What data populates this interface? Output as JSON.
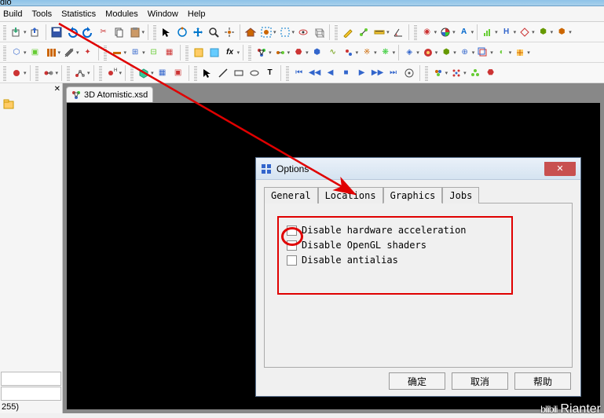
{
  "app": {
    "title_fragment": "dio"
  },
  "menu": {
    "items": [
      "Build",
      "Tools",
      "Statistics",
      "Modules",
      "Window",
      "Help"
    ]
  },
  "document": {
    "tab_label": "3D Atomistic.xsd"
  },
  "dialog": {
    "title": "Options",
    "tabs": [
      "General",
      "Locations",
      "Graphics",
      "Jobs"
    ],
    "active_tab": "Graphics",
    "graphics": {
      "chk1": "Disable hardware acceleration",
      "chk2": "Disable OpenGL shaders",
      "chk3": "Disable antialias"
    },
    "buttons": {
      "ok": "确定",
      "cancel": "取消",
      "help": "帮助"
    }
  },
  "status": {
    "value_255": "255)"
  },
  "watermark": {
    "text": "Rianter",
    "brand": "bilibili"
  }
}
